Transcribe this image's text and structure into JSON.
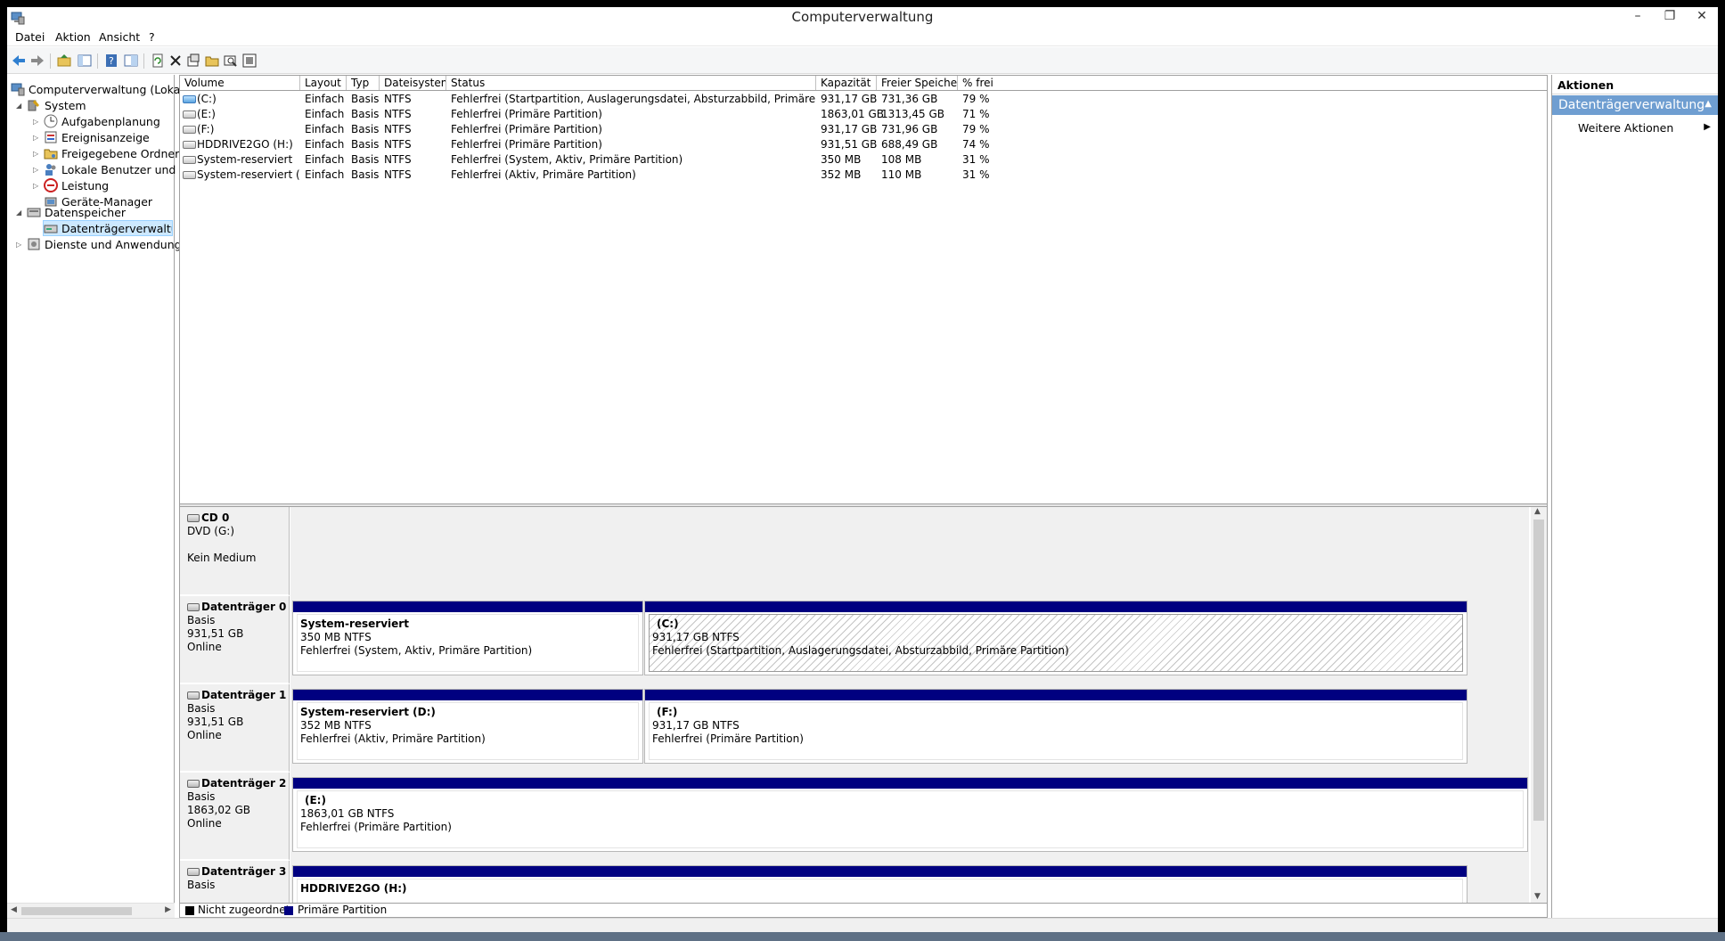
{
  "window": {
    "title": "Computerverwaltung",
    "minimize": "–",
    "maximize": "❐",
    "close": "✕"
  },
  "menu": [
    "Datei",
    "Aktion",
    "Ansicht",
    "?"
  ],
  "toolbar_icons": [
    "back-icon",
    "forward-icon",
    "up-icon",
    "show-hide-tree-icon",
    "help-icon",
    "properties-icon",
    "refresh-icon",
    "delete-icon",
    "new-icon",
    "open-icon",
    "search-icon",
    "settings-icon"
  ],
  "tree": {
    "root": "Computerverwaltung (Lokal)",
    "system": "System",
    "aufgabenplanung": "Aufgabenplanung",
    "ereignisanzeige": "Ereignisanzeige",
    "freigegebene": "Freigegebene Ordner",
    "lokale": "Lokale Benutzer und Gr",
    "leistung": "Leistung",
    "geraete": "Geräte-Manager",
    "datenspeicher": "Datenspeicher",
    "datentraeger": "Datenträgerverwaltung",
    "dienste": "Dienste und Anwendungen"
  },
  "volumes": {
    "headers": {
      "volume": "Volume",
      "layout": "Layout",
      "typ": "Typ",
      "fs": "Dateisystem",
      "status": "Status",
      "kap": "Kapazität",
      "frei": "Freier Speicher",
      "pct": "% frei"
    },
    "rows": [
      {
        "volume": "(C:)",
        "layout": "Einfach",
        "typ": "Basis",
        "fs": "NTFS",
        "status": "Fehlerfrei (Startpartition, Auslagerungsdatei, Absturzabbild, Primäre Partition)",
        "kap": "931,17 GB",
        "frei": "731,36 GB",
        "pct": "79 %"
      },
      {
        "volume": "(E:)",
        "layout": "Einfach",
        "typ": "Basis",
        "fs": "NTFS",
        "status": "Fehlerfrei (Primäre Partition)",
        "kap": "1863,01 GB",
        "frei": "1313,45 GB",
        "pct": "71 %"
      },
      {
        "volume": "(F:)",
        "layout": "Einfach",
        "typ": "Basis",
        "fs": "NTFS",
        "status": "Fehlerfrei (Primäre Partition)",
        "kap": "931,17 GB",
        "frei": "731,96 GB",
        "pct": "79 %"
      },
      {
        "volume": "HDDRIVE2GO (H:)",
        "layout": "Einfach",
        "typ": "Basis",
        "fs": "NTFS",
        "status": "Fehlerfrei (Primäre Partition)",
        "kap": "931,51 GB",
        "frei": "688,49 GB",
        "pct": "74 %"
      },
      {
        "volume": "System-reserviert",
        "layout": "Einfach",
        "typ": "Basis",
        "fs": "NTFS",
        "status": "Fehlerfrei (System, Aktiv, Primäre Partition)",
        "kap": "350 MB",
        "frei": "108 MB",
        "pct": "31 %"
      },
      {
        "volume": "System-reserviert (D:)",
        "layout": "Einfach",
        "typ": "Basis",
        "fs": "NTFS",
        "status": "Fehlerfrei (Aktiv, Primäre Partition)",
        "kap": "352 MB",
        "frei": "110 MB",
        "pct": "31 %"
      }
    ]
  },
  "disks": {
    "cd0": {
      "name": "CD 0",
      "l1": "DVD (G:)",
      "l3": "Kein Medium"
    },
    "d0": {
      "name": "Datenträger 0",
      "l1": "Basis",
      "l2": "931,51 GB",
      "l3": "Online",
      "p1": {
        "title": "System-reserviert",
        "size": "350 MB NTFS",
        "status": "Fehlerfrei (System, Aktiv, Primäre Partition)"
      },
      "p2": {
        "title": "(C:)",
        "size": "931,17 GB NTFS",
        "status": "Fehlerfrei (Startpartition, Auslagerungsdatei, Absturzabbild, Primäre Partition)"
      }
    },
    "d1": {
      "name": "Datenträger 1",
      "l1": "Basis",
      "l2": "931,51 GB",
      "l3": "Online",
      "p1": {
        "title": "System-reserviert  (D:)",
        "size": "352 MB NTFS",
        "status": "Fehlerfrei (Aktiv, Primäre Partition)"
      },
      "p2": {
        "title": "(F:)",
        "size": "931,17 GB NTFS",
        "status": "Fehlerfrei (Primäre Partition)"
      }
    },
    "d2": {
      "name": "Datenträger 2",
      "l1": "Basis",
      "l2": "1863,02 GB",
      "l3": "Online",
      "p1": {
        "title": "(E:)",
        "size": "1863,01 GB NTFS",
        "status": "Fehlerfrei (Primäre Partition)"
      }
    },
    "d3": {
      "name": "Datenträger 3",
      "l1": "Basis",
      "p1": {
        "title": "HDDRIVE2GO  (H:)"
      }
    }
  },
  "legend": {
    "unallocated": "Nicht zugeordnet",
    "primary": "Primäre Partition",
    "unallocated_color": "#000000",
    "primary_color": "#000080"
  },
  "actions": {
    "title": "Aktionen",
    "group": "Datenträgerverwaltung",
    "more": "Weitere Aktionen"
  }
}
